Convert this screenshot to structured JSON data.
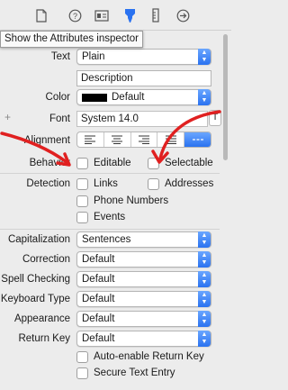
{
  "toolbar": {
    "icons": [
      "file-icon",
      "help-icon",
      "identity-icon",
      "attributes-icon",
      "size-icon",
      "connections-icon"
    ],
    "selected": "attributes-icon"
  },
  "tooltip": "Show the Attributes inspector",
  "rows": {
    "text": {
      "label": "Text",
      "value": "Plain"
    },
    "description": "Description",
    "color": {
      "label": "Color",
      "value": "Default"
    },
    "font": {
      "label": "Font",
      "value": "System 14.0",
      "glyph": "T"
    },
    "alignment": {
      "label": "Alignment"
    },
    "behavior": {
      "label": "Behavior",
      "editable": "Editable",
      "selectable": "Selectable"
    },
    "detection": {
      "label": "Detection",
      "links": "Links",
      "addresses": "Addresses",
      "phone": "Phone Numbers",
      "events": "Events"
    },
    "capitalization": {
      "label": "Capitalization",
      "value": "Sentences"
    },
    "correction": {
      "label": "Correction",
      "value": "Default"
    },
    "spell": {
      "label": "Spell Checking",
      "value": "Default"
    },
    "keyboard": {
      "label": "Keyboard Type",
      "value": "Default"
    },
    "appearance": {
      "label": "Appearance",
      "value": "Default"
    },
    "return_key": {
      "label": "Return Key",
      "value": "Default"
    },
    "auto_return": "Auto-enable Return Key",
    "secure": "Secure Text Entry"
  },
  "colors": {
    "accent": "#2a72f0",
    "annotation": "#e02020"
  }
}
